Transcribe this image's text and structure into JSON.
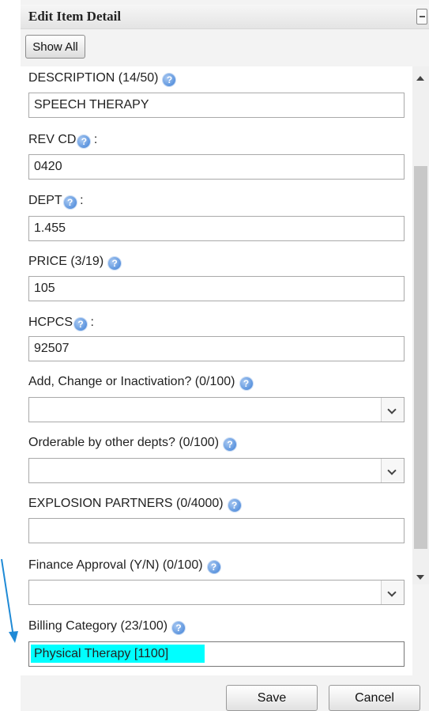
{
  "panel": {
    "title": "Edit Item Detail",
    "show_all_label": "Show All"
  },
  "fields": [
    {
      "label": "DESCRIPTION (14/50)",
      "value": "SPEECH THERAPY",
      "type": "text"
    },
    {
      "label": "REV CD",
      "suffix": ":",
      "value": "0420",
      "type": "text"
    },
    {
      "label": "DEPT",
      "suffix": ":",
      "value": "1.455",
      "type": "text"
    },
    {
      "label": "PRICE (3/19)",
      "value": "105",
      "type": "text"
    },
    {
      "label": "HCPCS",
      "suffix": ":",
      "value": "92507",
      "type": "text"
    },
    {
      "label": "Add, Change or Inactivation? (0/100)",
      "value": "",
      "type": "select"
    },
    {
      "label": "Orderable by other depts? (0/100)",
      "value": "",
      "type": "select"
    },
    {
      "label": "EXPLOSION PARTNERS (0/4000)",
      "value": "",
      "type": "text"
    },
    {
      "label": "Finance Approval (Y/N) (0/100)",
      "value": "",
      "type": "select"
    },
    {
      "label": "Billing Category (23/100)",
      "value": "Physical Therapy [1100]",
      "type": "text",
      "highlighted": true
    }
  ],
  "footer": {
    "save_label": "Save",
    "cancel_label": "Cancel"
  },
  "colors": {
    "highlight": "#00ffff",
    "annotation_arrow": "#1f8ad6",
    "help_icon": "#3d7fd6"
  },
  "icons": {
    "help": "help-question-icon",
    "collapse": "collapse-minus-icon",
    "dropdown": "chevron-down-icon"
  }
}
